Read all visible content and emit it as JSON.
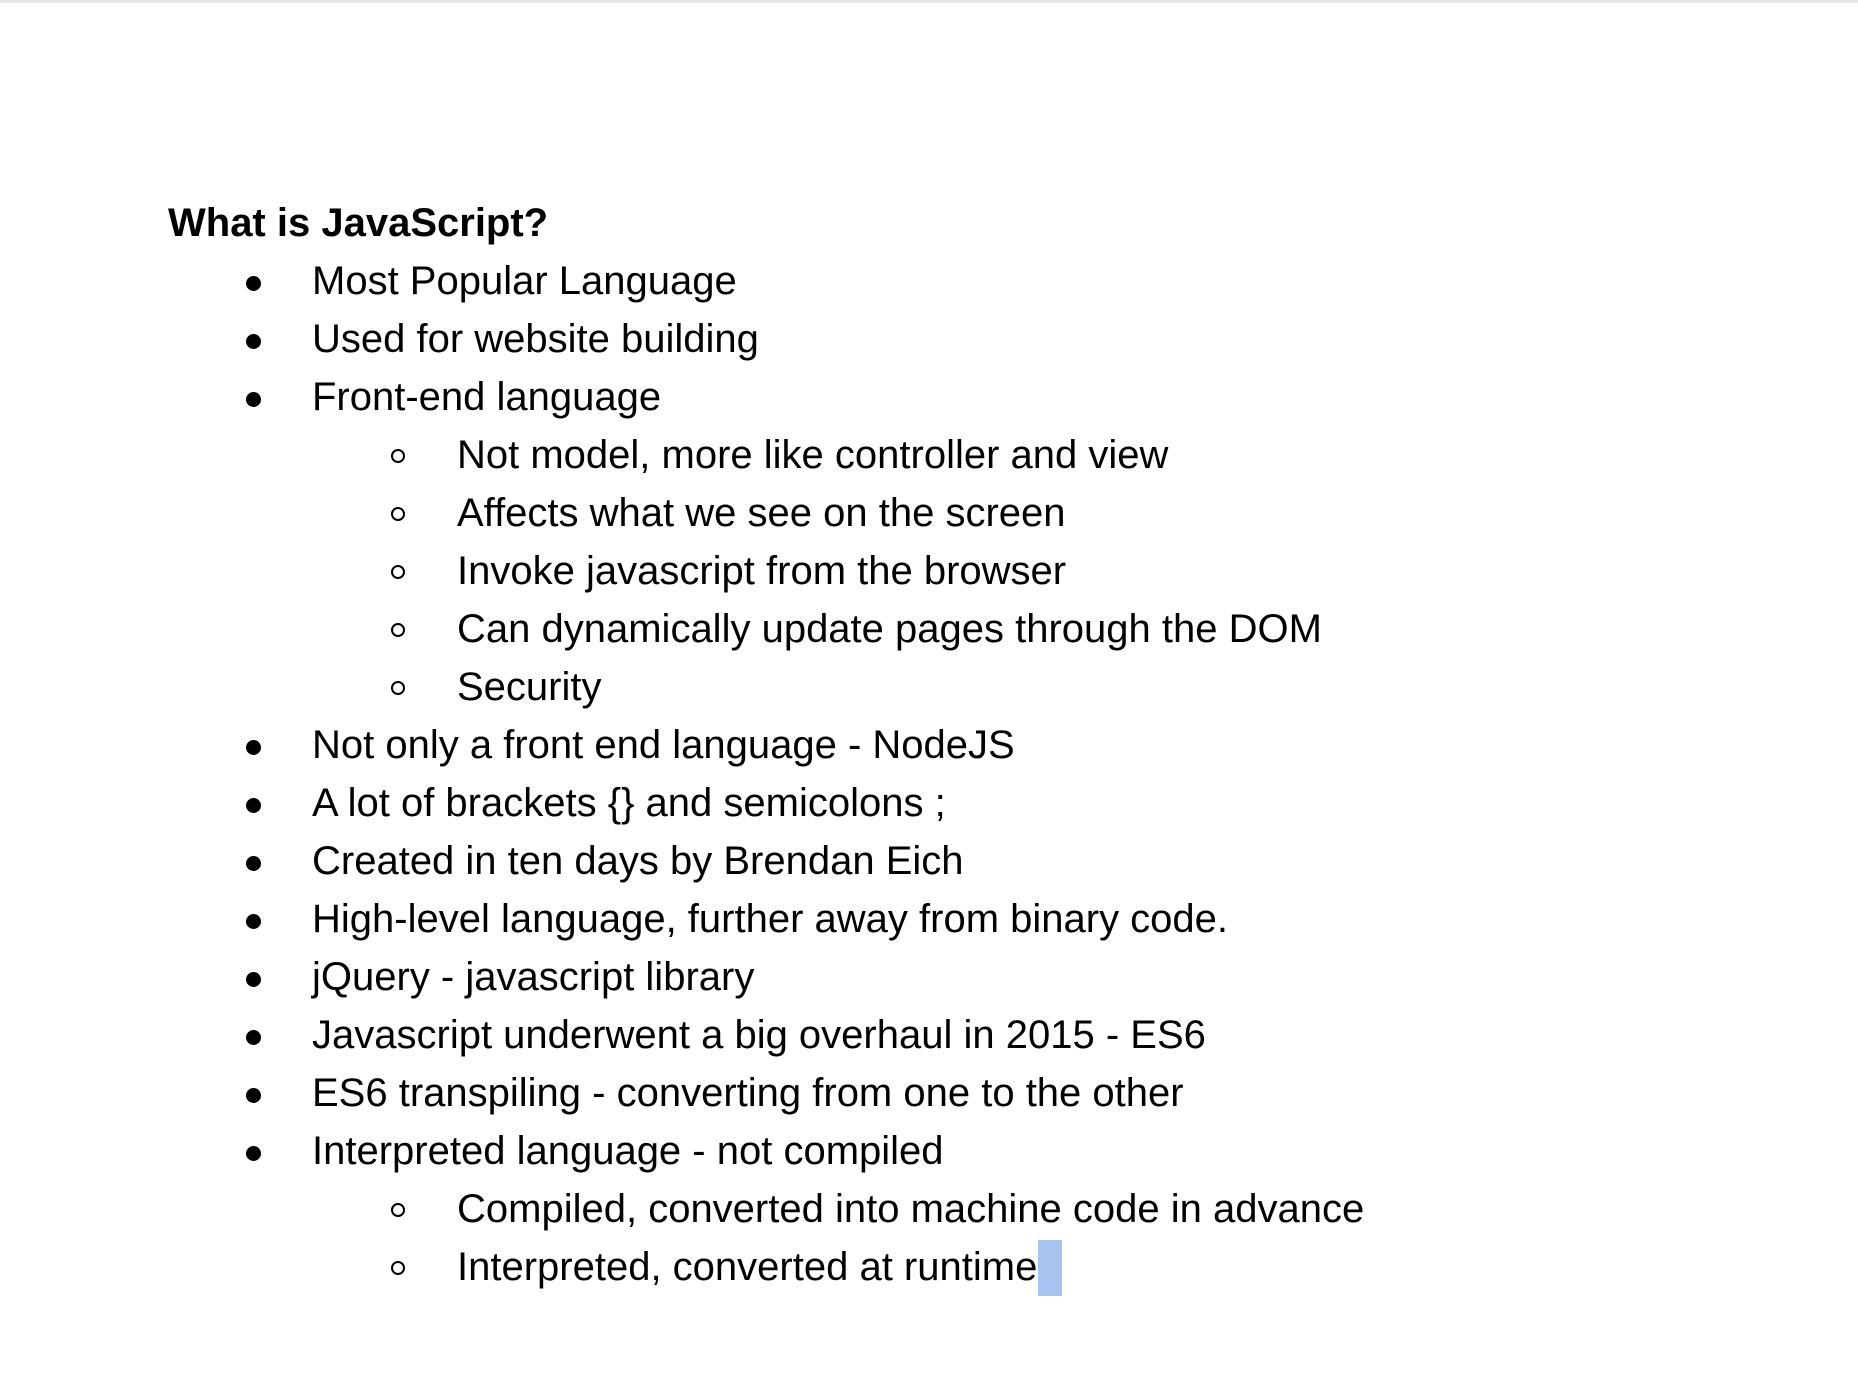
{
  "document": {
    "heading": "What is JavaScript?",
    "bullets": [
      "Most Popular Language",
      "Used for website building",
      "Front-end language",
      "Not model, more like controller and view",
      "Affects what we see on the screen",
      "Invoke javascript from the browser",
      "Can dynamically update pages through the DOM",
      "Security",
      "Not only a front end language - NodeJS",
      "A lot of brackets {} and semicolons ;",
      "Created in ten days by Brendan Eich",
      "High-level language, further away from binary code.",
      "jQuery - javascript library",
      "Javascript underwent a big overhaul in 2015 - ES6",
      "ES6 transpiling - converting from one to the other",
      "Interpreted language - not compiled",
      "Compiled, converted into machine code in advance",
      "Interpreted, converted at runtime"
    ]
  },
  "colors": {
    "text": "#000000",
    "selection": "#a8c3f0",
    "background": "#ffffff"
  }
}
